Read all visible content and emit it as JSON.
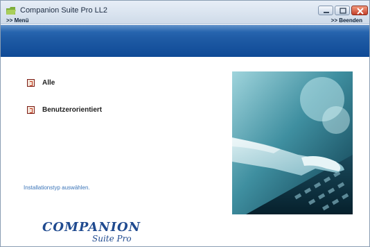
{
  "window": {
    "title": "Companion Suite Pro LL2"
  },
  "menubar": {
    "menu_label": ">> Menü",
    "exit_label": ">> Beenden"
  },
  "options": [
    {
      "label": "Alle"
    },
    {
      "label": "Benutzerorientiert"
    }
  ],
  "hint": "Installationstyp auswählen.",
  "logo": {
    "line1": "COMPANION",
    "line2": "Suite Pro"
  },
  "colors": {
    "header_band": "#1e5aa4",
    "hint_text": "#3a74b8",
    "logo": "#1f4a8f"
  },
  "icons": {
    "app": "folder-icon",
    "minimize": "minimize-icon",
    "maximize": "maximize-icon",
    "close": "close-icon",
    "option": "option-box-icon"
  }
}
